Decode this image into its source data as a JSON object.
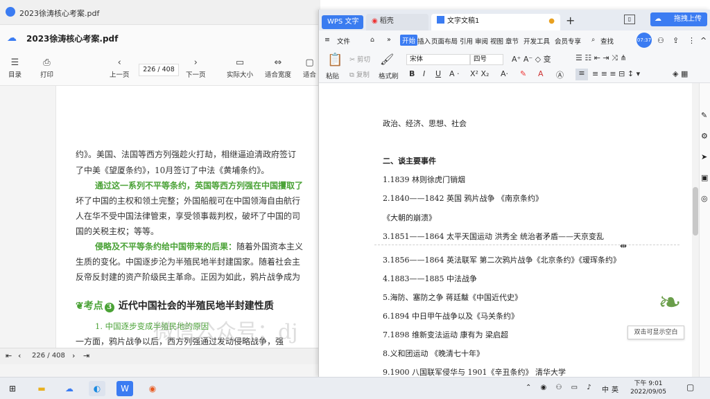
{
  "pdf": {
    "tab_title": "2023徐涛核心考案.pdf",
    "title": "2023徐涛核心考案.pdf",
    "tools": {
      "toc": "目录",
      "print": "打印",
      "prev": "上一页",
      "next": "下一页",
      "actual": "实际大小",
      "fit_width": "适合宽度",
      "fit_page": "适合"
    },
    "page_current": "226",
    "page_sep": "/",
    "page_total": "408",
    "status_pages": "226 / 408",
    "lines": [
      "约》。美国、法国等西方列强趁火打劫，相继逼迫清政府签订",
      "了中美《望厦条约》，10月签订了中法《黄埔条约》。",
      "坏了中国的主权和领土完整；外国船舰可在中国领海自由航行",
      "人在华不受中国法律管束，享受领事裁判权，破坏了中国的司",
      "国的关税主权；等等。",
      "生质的变化。中国逐步沦为半殖民地半封建国家。随着社会主",
      "反帝反封建的资产阶级民主革命。正因为如此，鸦片战争成为",
      "一方面，鸦片战争以后，西方列强通过发动侵略战争，强"
    ],
    "green_lines": [
      "通过这一系列不平等条约，英国等西方列强在中国攫取了",
      "1. 中国逐步变成半殖民地的原因"
    ],
    "mixed_line": {
      "green": "侵略及不平等条约给中国带来的后果：",
      "black": "随着外国资本主义"
    },
    "kaodian_label": "考点",
    "kaodian_num": "3",
    "kaodian_title": "近代中国社会的半殖民地半封建性质",
    "watermark": "微信公众号：dj"
  },
  "wps": {
    "tabs": {
      "wps": "WPS 文字",
      "daoke": "稻壳",
      "doc": "文字文稿1",
      "add": "+"
    },
    "upload": "拖拽上传",
    "menu": [
      "文件",
      "开始",
      "插入",
      "页面布局",
      "引用",
      "审阅",
      "视图",
      "章节",
      "开发工具",
      "会员专享"
    ],
    "search": "查找",
    "avatar_text": "07:37",
    "ribbon": {
      "paste": "粘贴",
      "cut": "剪切",
      "copy": "复制",
      "format_painter": "格式刷",
      "font": "宋体",
      "size": "四号"
    },
    "doc_lines": [
      "政治、经济、思想、社会",
      "二、谈主要事件",
      "1.1839 林则徐虎门销烟",
      "2.1840——1842  英国 鸦片战争 《南京条约》",
      "《大朝的崩溃》",
      "3.1851——1864  太平天国运动 洪秀全 统治者矛盾——天京变乱",
      "3.1856——1864 英法联军 第二次鸦片战争《北京条约》《瑷珲条约》",
      "4.1883——1885 中法战争",
      "5.海防、塞防之争 蒋廷黻《中国近代史》",
      "6.1894 中日甲午战争以及《马关条约》",
      "7.1898 维新变法运动 康有为 梁启超",
      "8.义和团运动 《晚清七十年》",
      "9.1900 八国联军侵华与 1901《辛丑条约》 清华大学"
    ],
    "tooltip": "双击可显示空白"
  },
  "taskbar": {
    "time": "下午 9:01",
    "date": "2022/09/05",
    "ime": "中",
    "vol": "英"
  }
}
